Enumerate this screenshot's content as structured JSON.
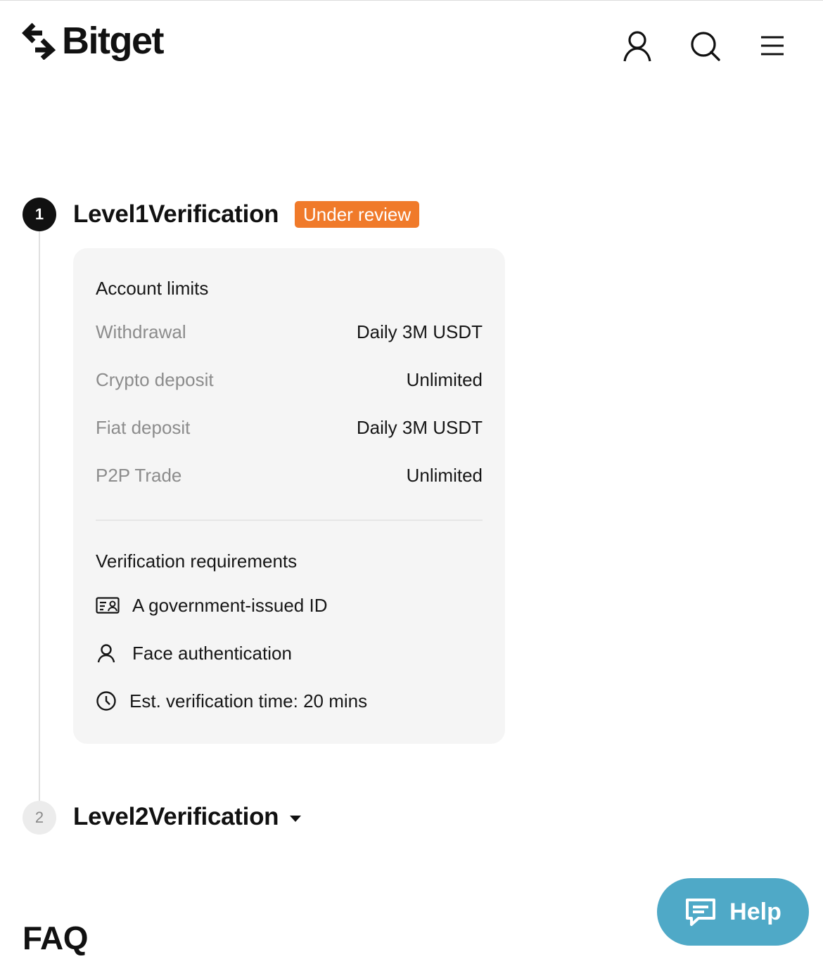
{
  "header": {
    "logo_text": "Bitget",
    "icons": [
      "user-icon",
      "search-icon",
      "menu-icon"
    ]
  },
  "level1": {
    "step_number": "1",
    "title": "Level1Verification",
    "status": "Under review",
    "limits_heading": "Account limits",
    "limits": [
      {
        "label": "Withdrawal",
        "value": "Daily 3M USDT"
      },
      {
        "label": "Crypto deposit",
        "value": "Unlimited"
      },
      {
        "label": "Fiat deposit",
        "value": "Daily 3M USDT"
      },
      {
        "label": "P2P Trade",
        "value": "Unlimited"
      }
    ],
    "requirements_heading": "Verification requirements",
    "requirements": [
      {
        "icon": "id-card-icon",
        "text": "A government-issued ID"
      },
      {
        "icon": "person-icon",
        "text": "Face authentication"
      },
      {
        "icon": "clock-icon",
        "text": "Est. verification time: 20 mins"
      }
    ]
  },
  "level2": {
    "step_number": "2",
    "title": "Level2Verification"
  },
  "faq": {
    "title": "FAQ"
  },
  "help": {
    "label": "Help"
  },
  "colors": {
    "status_badge": "#f07a2a",
    "help_button": "#4fa9c7",
    "card_bg": "#f5f5f5"
  }
}
